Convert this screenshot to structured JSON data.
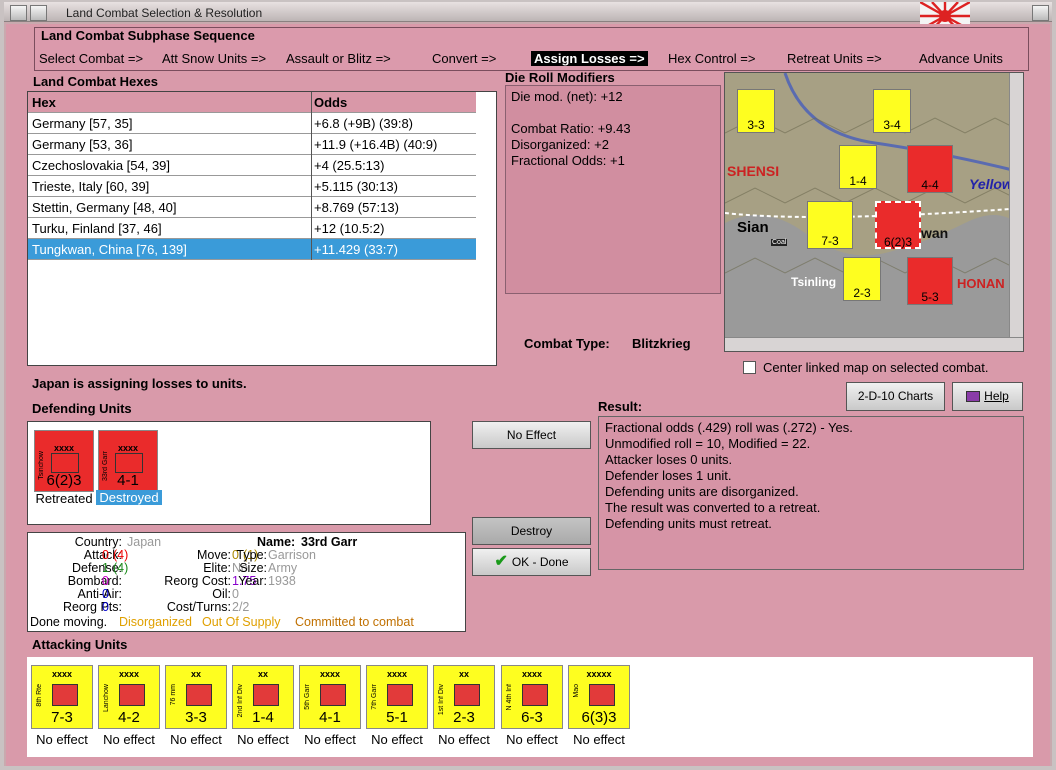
{
  "window": {
    "title": "Land Combat Selection & Resolution"
  },
  "subphase": {
    "heading": "Land Combat Subphase Sequence",
    "phases": [
      "Select Combat =>",
      "Att Snow Units =>",
      "Assault or Blitz =>",
      "Convert =>",
      "Assign Losses =>",
      "Hex Control =>",
      "Retreat Units =>",
      "Advance Units"
    ],
    "selected_index": 4
  },
  "hexes": {
    "heading": "Land Combat Hexes",
    "col_hex": "Hex",
    "col_odds": "Odds",
    "rows": [
      {
        "hex": "Germany [57, 35]",
        "odds": "+6.8 (+9B) (39:8)"
      },
      {
        "hex": "Germany [53, 36]",
        "odds": "+11.9 (+16.4B) (40:9)"
      },
      {
        "hex": "Czechoslovakia [54, 39]",
        "odds": "+4 (25.5:13)"
      },
      {
        "hex": "Trieste, Italy [60, 39]",
        "odds": "+5.115 (30:13)"
      },
      {
        "hex": "Stettin, Germany [48, 40]",
        "odds": "+8.769 (57:13)"
      },
      {
        "hex": "Turku, Finland [37, 46]",
        "odds": "+12 (10.5:2)"
      },
      {
        "hex": "Tungkwan, China [76, 139]",
        "odds": "+11.429 (33:7)"
      }
    ],
    "selected_index": 6
  },
  "modifiers": {
    "heading": "Die Roll Modifiers",
    "net": "Die mod. (net): +12",
    "lines": [
      "Combat Ratio: +9.43",
      "Disorganized: +2",
      "Fractional Odds: +1"
    ]
  },
  "combat_type": {
    "label": "Combat Type:",
    "value": "Blitzkrieg"
  },
  "map": {
    "labels": [
      "SHENSI",
      "Yellow",
      "Sian",
      "wan",
      "Tsinling",
      "HONAN",
      "Coal"
    ],
    "units": [
      {
        "type": "xxx",
        "str": "3-3"
      },
      {
        "type": "xxx",
        "str": "3-4"
      },
      {
        "type": "xx",
        "str": "1-4"
      },
      {
        "type": "xxx",
        "str": "4-4"
      },
      {
        "type": "xxxx",
        "str": "7-3"
      },
      {
        "type": "xx",
        "str": "2-3"
      },
      {
        "type": "xxxx",
        "str": "5-3"
      },
      {
        "type": "xxxx",
        "str": "6(2)3"
      }
    ]
  },
  "center_map": {
    "label": "Center linked map on selected combat.",
    "checked": false
  },
  "buttons": {
    "charts": "2-D-10 Charts",
    "help": "Help",
    "no_effect": "No Effect",
    "destroy": "Destroy",
    "ok": "OK - Done"
  },
  "status": "Japan is assigning losses to units.",
  "defending": {
    "heading": "Defending Units",
    "units": [
      {
        "name": "Tsinchow",
        "type": "xxxx",
        "str": "6(2)3",
        "status": "Retreated"
      },
      {
        "name": "33rd Garr",
        "type": "xxxx",
        "str": "4-1",
        "status": "Destroyed"
      }
    ]
  },
  "result": {
    "heading": "Result:",
    "lines": [
      "Fractional odds (.429) roll was (.272)  - Yes.",
      "Unmodified roll = 10, Modified = 22.",
      "Attacker loses 0 units.",
      "Defender loses 1 unit.",
      "Defending units are disorganized.",
      "The result was converted to a retreat.",
      "Defending units must retreat."
    ]
  },
  "info": {
    "country_label": "Country:",
    "country": "Japan",
    "name_label": "Name:",
    "name": "33rd Garr",
    "attack_label": "Attack:",
    "attack": "0",
    "attack_x": "(4)",
    "move_label": "Move:",
    "move": "0",
    "move_x": "(1)",
    "type_label": "Type:",
    "type": "Garrison",
    "defense_label": "Defense:",
    "defense": "1",
    "defense_x": "(4)",
    "elite_label": "Elite:",
    "elite": "No",
    "size_label": "Size:",
    "size": "Army",
    "bombard_label": "Bombard:",
    "bombard": "0",
    "reorg_label": "Reorg Cost:",
    "reorg": "1.75",
    "year_label": "Year:",
    "year": "1938",
    "aa_label": "Anti-Air:",
    "aa": "0",
    "oil_label": "Oil:",
    "oil": "0",
    "rpts_label": "Reorg Pts:",
    "rpts": "0",
    "cost_label": "Cost/Turns:",
    "cost": "2/2",
    "done": "Done moving.",
    "disorg": "Disorganized",
    "supply": "Out Of Supply",
    "committed": "Committed to combat"
  },
  "attacking": {
    "heading": "Attacking Units",
    "units": [
      {
        "name": "8th Rte",
        "type": "xxxx",
        "str": "7-3",
        "status": "No effect"
      },
      {
        "name": "Lanchow",
        "type": "xxxx",
        "str": "4-2",
        "status": "No effect"
      },
      {
        "name": "76 mm",
        "type": "xx",
        "str": "3-3",
        "status": "No effect"
      },
      {
        "name": "2nd Inf Div",
        "type": "xx",
        "str": "1-4",
        "status": "No effect"
      },
      {
        "name": "5th Garr",
        "type": "xxxx",
        "str": "4-1",
        "status": "No effect"
      },
      {
        "name": "7th Garr",
        "type": "xxxx",
        "str": "5-1",
        "status": "No effect"
      },
      {
        "name": "1st Inf Div",
        "type": "xx",
        "str": "2-3",
        "status": "No effect"
      },
      {
        "name": "N 4th Inf",
        "type": "xxxx",
        "str": "6-3",
        "status": "No effect"
      },
      {
        "name": "Mao",
        "type": "xxxxx",
        "str": "6(3)3",
        "status": "No effect"
      }
    ]
  },
  "colors": {
    "panel": "#d99aaa",
    "selected": "#3a9bd9",
    "axis_unit": "#fefe20",
    "allied_unit": "#ea2b2b"
  }
}
